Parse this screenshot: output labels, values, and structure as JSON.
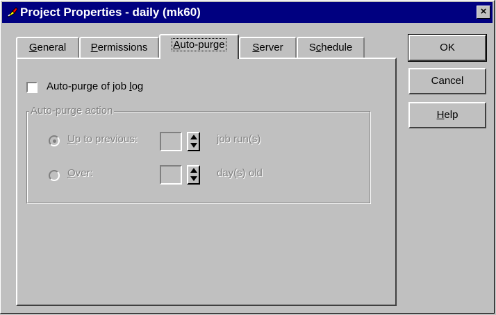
{
  "window": {
    "title": "Project Properties - daily (mk60)",
    "close_label": "×"
  },
  "tabs": [
    {
      "pre": "",
      "key": "G",
      "post": "eneral"
    },
    {
      "pre": "",
      "key": "P",
      "post": "ermissions"
    },
    {
      "pre": "",
      "key": "A",
      "post": "uto-purge"
    },
    {
      "pre": "",
      "key": "S",
      "post": "erver"
    },
    {
      "pre": "S",
      "key": "c",
      "post": "hedule"
    }
  ],
  "active_tab": "Auto-purge",
  "buttons": {
    "ok": "OK",
    "cancel": "Cancel",
    "help_key": "H",
    "help_rest": "elp"
  },
  "autopurge": {
    "checkbox_pre": "Auto-purge of job ",
    "checkbox_key": "l",
    "checkbox_post": "og",
    "checked": false,
    "group_title": "Auto-purge action",
    "opt1_key": "U",
    "opt1_rest": "p to previous:",
    "opt1_unit": "job run(s)",
    "opt2_key": "O",
    "opt2_rest": "ver:",
    "opt2_unit": "day(s) old",
    "opt1_value": "",
    "opt2_value": ""
  }
}
